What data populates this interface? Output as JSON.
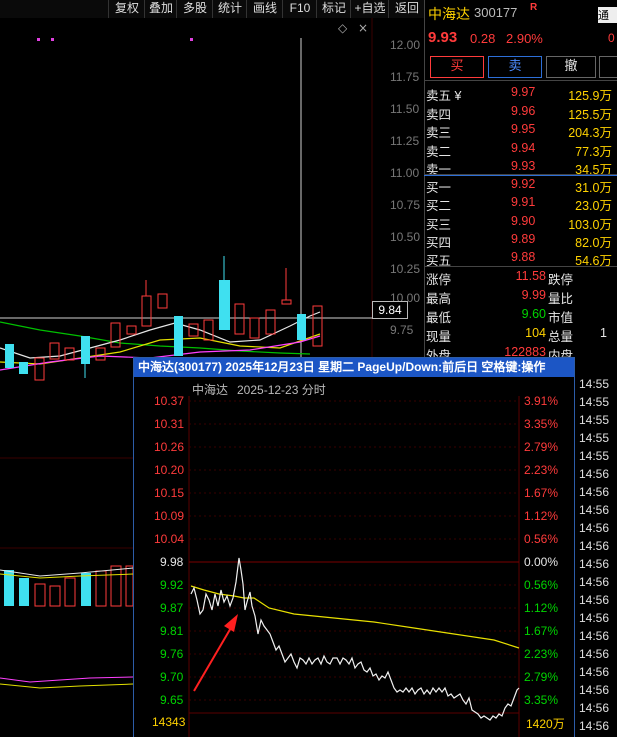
{
  "toolbar": {
    "buttons": [
      "复权",
      "叠加",
      "多股",
      "统计",
      "画线",
      "F10",
      "标记",
      "+自选",
      "返回"
    ]
  },
  "kline": {
    "y_ticks": [
      "12.00",
      "11.75",
      "11.50",
      "11.25",
      "11.00",
      "10.75",
      "10.50",
      "10.25",
      "10.00",
      "9.75"
    ],
    "price_marker": "9.84",
    "diamond_icon": "◇",
    "close_icon": "×"
  },
  "quote": {
    "name": "中海达",
    "code": "300177",
    "badge": "R",
    "price": "9.93",
    "change": "0.28",
    "change_pct": "2.90%",
    "tag_right": "通付",
    "tag_right2": "0",
    "buy_label": "买",
    "sell_label": "卖",
    "cancel_label": "撤",
    "asks": [
      {
        "label": "卖五 ¥",
        "price": "9.97",
        "vol": "125.9万"
      },
      {
        "label": "卖四",
        "price": "9.96",
        "vol": "125.5万"
      },
      {
        "label": "卖三",
        "price": "9.95",
        "vol": "204.3万"
      },
      {
        "label": "卖二",
        "price": "9.94",
        "vol": "77.3万"
      },
      {
        "label": "卖一",
        "price": "9.93",
        "vol": "34.5万"
      }
    ],
    "bids": [
      {
        "label": "买一",
        "price": "9.92",
        "vol": "31.0万"
      },
      {
        "label": "买二",
        "price": "9.91",
        "vol": "23.0万"
      },
      {
        "label": "买三",
        "price": "9.90",
        "vol": "103.0万"
      },
      {
        "label": "买四",
        "price": "9.89",
        "vol": "82.0万"
      },
      {
        "label": "买五",
        "price": "9.88",
        "vol": "54.6万"
      }
    ],
    "stats": [
      {
        "k1": "涨停",
        "v1": "11.58",
        "k2": "跌停",
        "v2": ""
      },
      {
        "k1": "最高",
        "v1": "9.99",
        "k2": "量比",
        "v2": ""
      },
      {
        "k1": "最低",
        "v1": "9.60",
        "k2": "市值",
        "v2": ""
      },
      {
        "k1": "现量",
        "v1": "104",
        "k2": "总量",
        "v2": "1"
      },
      {
        "k1": "外盘",
        "v1": "122883",
        "k2": "内盘",
        "v2": ""
      }
    ]
  },
  "popup": {
    "title": "中海达(300177)  2025年12月23日 星期二 PageUp/Down:前后日 空格键:操作",
    "subtitle_name": "中海达",
    "subtitle_date": "2025-12-23 分时",
    "left_prices": [
      "10.37",
      "10.31",
      "10.26",
      "10.20",
      "10.15",
      "10.09",
      "10.04",
      "9.98",
      "9.92",
      "9.87",
      "9.81",
      "9.76",
      "9.70",
      "9.65"
    ],
    "right_pcts": [
      "3.91%",
      "3.35%",
      "2.79%",
      "2.23%",
      "1.67%",
      "1.12%",
      "0.56%",
      "0.00%",
      "0.56%",
      "1.12%",
      "1.67%",
      "2.23%",
      "2.79%",
      "3.35%"
    ],
    "vol_left": "14343",
    "vol_right": "1420万"
  },
  "time_ticks": [
    "14:55",
    "14:55",
    "14:55",
    "14:55",
    "14:55",
    "14:56",
    "14:56",
    "14:56",
    "14:56",
    "14:56",
    "14:56",
    "14:56",
    "14:56",
    "14:56",
    "14:56",
    "14:56",
    "14:56",
    "14:56",
    "14:56",
    "14:56"
  ]
}
